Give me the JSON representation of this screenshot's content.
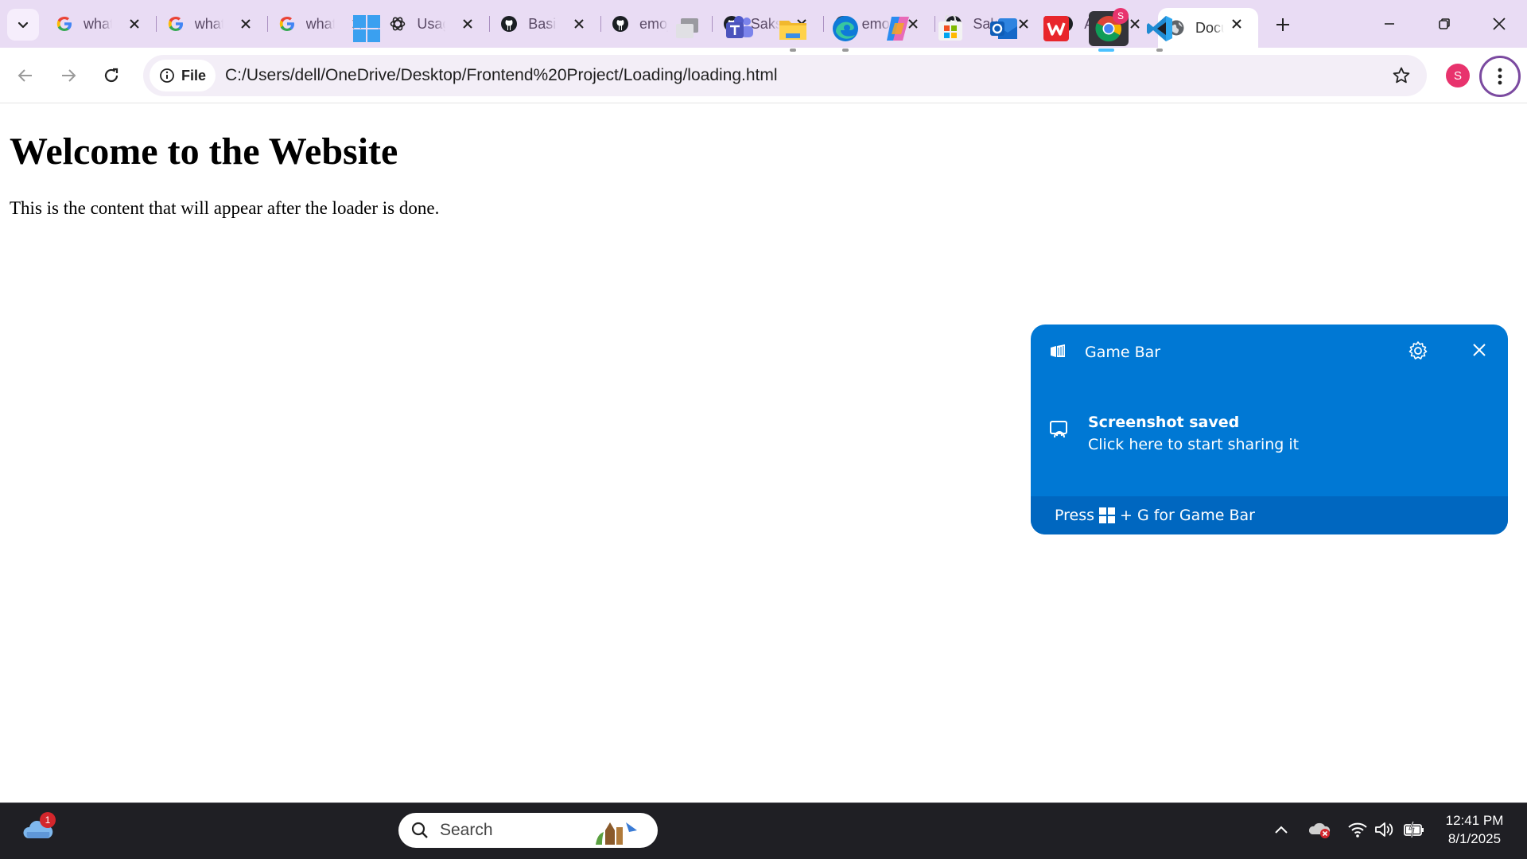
{
  "browser": {
    "tabs": [
      {
        "title": "what is",
        "icon": "google-icon"
      },
      {
        "title": "what is",
        "icon": "google-icon"
      },
      {
        "title": "what is",
        "icon": "google-icon"
      },
      {
        "title": "Usage",
        "icon": "openai-icon"
      },
      {
        "title": "Basic",
        "icon": "github-icon"
      },
      {
        "title": "emoji",
        "icon": "github-icon"
      },
      {
        "title": "Saksh",
        "icon": "github-icon"
      },
      {
        "title": "emoji",
        "icon": "github-icon"
      },
      {
        "title": "Saksh",
        "icon": "github-icon"
      },
      {
        "title": "ATM",
        "icon": "github-icon"
      },
      {
        "title": "Document",
        "icon": "globe-icon",
        "active": true
      }
    ],
    "address_chip": "File",
    "url": "C:/Users/dell/OneDrive/Desktop/Frontend%20Project/Loading/loading.html",
    "profile_initial": "S",
    "accent": "#e9dcf4"
  },
  "page": {
    "heading": "Welcome to the Website",
    "paragraph": "This is the content that will appear after the loader is done."
  },
  "toast": {
    "app_name": "Game Bar",
    "headline": "Screenshot saved",
    "subline": "Click here to start sharing it",
    "footer_prefix": "Press",
    "footer_suffix": "+ G for Game Bar",
    "color": "#0078d4"
  },
  "taskbar": {
    "weather_badge": "1",
    "search_placeholder": "Search",
    "chrome_badge": "S",
    "time": "12:41 PM",
    "date": "8/1/2025"
  }
}
